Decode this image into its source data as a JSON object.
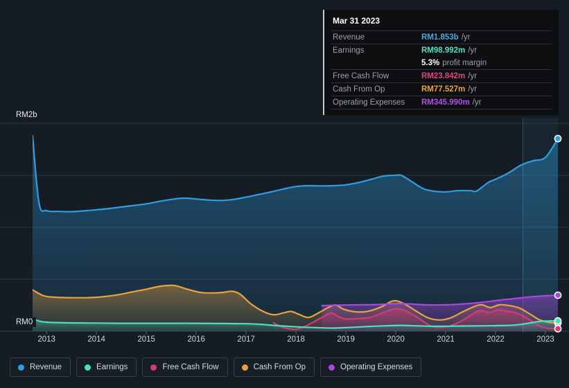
{
  "background_color": "#151c24",
  "tooltip": {
    "date": "Mar 31 2023",
    "rows": [
      {
        "label": "Revenue",
        "value": "RM1.853b",
        "unit": "/yr",
        "color": "#49a7e8"
      },
      {
        "label": "Earnings",
        "value": "RM98.992m",
        "unit": "/yr",
        "color": "#4ce0c0"
      },
      {
        "label": "",
        "value": "5.3%",
        "unit": "profit margin",
        "color": "#ffffff"
      },
      {
        "label": "Free Cash Flow",
        "value": "RM23.842m",
        "unit": "/yr",
        "color": "#e0457c"
      },
      {
        "label": "Cash From Op",
        "value": "RM77.527m",
        "unit": "/yr",
        "color": "#e8a33d"
      },
      {
        "label": "Operating Expenses",
        "value": "RM345.990m",
        "unit": "/yr",
        "color": "#b44ce8"
      }
    ]
  },
  "axes": {
    "y_top_label": "RM2b",
    "y_zero_label": "RM0",
    "x_labels": [
      "2013",
      "2014",
      "2015",
      "2016",
      "2017",
      "2018",
      "2019",
      "2020",
      "2021",
      "2022",
      "2023"
    ]
  },
  "legend": [
    {
      "label": "Revenue",
      "color": "#2f9ee0"
    },
    {
      "label": "Earnings",
      "color": "#4ce0c0"
    },
    {
      "label": "Free Cash Flow",
      "color": "#d63b6f"
    },
    {
      "label": "Cash From Op",
      "color": "#e8a33d"
    },
    {
      "label": "Operating Expenses",
      "color": "#ab47e0"
    }
  ],
  "chart_data": {
    "type": "area",
    "title": "",
    "xlabel": "",
    "ylabel": "",
    "currency": "RM",
    "ylim": [
      0,
      2000000000
    ],
    "ytick_labels": [
      "RM0",
      "RM2b"
    ],
    "grid": true,
    "legend_position": "bottom",
    "x_axis_years": [
      "2013",
      "2014",
      "2015",
      "2016",
      "2017",
      "2018",
      "2019",
      "2020",
      "2021",
      "2022",
      "2023"
    ],
    "forecast_divider_year": 2022.55,
    "series": [
      {
        "name": "Revenue",
        "color": "#2f9ee0",
        "unit": "RM",
        "latest_value": "RM1.853b",
        "points": [
          [
            2012.72,
            1880
          ],
          [
            2012.85,
            1230
          ],
          [
            2013.0,
            1160
          ],
          [
            2013.25,
            1152
          ],
          [
            2013.5,
            1150
          ],
          [
            2013.75,
            1158
          ],
          [
            2014.0,
            1168
          ],
          [
            2014.25,
            1180
          ],
          [
            2014.5,
            1195
          ],
          [
            2014.75,
            1210
          ],
          [
            2015.0,
            1225
          ],
          [
            2015.25,
            1248
          ],
          [
            2015.5,
            1268
          ],
          [
            2015.75,
            1280
          ],
          [
            2016.0,
            1272
          ],
          [
            2016.25,
            1262
          ],
          [
            2016.5,
            1258
          ],
          [
            2016.75,
            1268
          ],
          [
            2017.0,
            1290
          ],
          [
            2017.25,
            1315
          ],
          [
            2017.5,
            1340
          ],
          [
            2017.75,
            1368
          ],
          [
            2018.0,
            1392
          ],
          [
            2018.25,
            1400
          ],
          [
            2018.5,
            1398
          ],
          [
            2018.75,
            1400
          ],
          [
            2019.0,
            1408
          ],
          [
            2019.25,
            1430
          ],
          [
            2019.5,
            1460
          ],
          [
            2019.75,
            1492
          ],
          [
            2020.0,
            1500
          ],
          [
            2020.12,
            1498
          ],
          [
            2020.35,
            1430
          ],
          [
            2020.55,
            1372
          ],
          [
            2020.75,
            1348
          ],
          [
            2021.0,
            1340
          ],
          [
            2021.25,
            1352
          ],
          [
            2021.5,
            1352
          ],
          [
            2021.62,
            1348
          ],
          [
            2021.85,
            1430
          ],
          [
            2022.0,
            1462
          ],
          [
            2022.25,
            1520
          ],
          [
            2022.5,
            1595
          ],
          [
            2022.75,
            1640
          ],
          [
            2023.0,
            1672
          ],
          [
            2023.25,
            1853
          ]
        ]
      },
      {
        "name": "Earnings",
        "color": "#4ce0c0",
        "unit": "RM",
        "latest_value": "RM98.992m",
        "points": [
          [
            2012.72,
            118
          ],
          [
            2012.9,
            92
          ],
          [
            2013.1,
            84
          ],
          [
            2013.5,
            80
          ],
          [
            2014.0,
            78
          ],
          [
            2014.5,
            76
          ],
          [
            2015.0,
            76
          ],
          [
            2015.5,
            76
          ],
          [
            2016.0,
            76
          ],
          [
            2016.5,
            74
          ],
          [
            2017.0,
            72
          ],
          [
            2017.3,
            66
          ],
          [
            2017.6,
            54
          ],
          [
            2018.0,
            42
          ],
          [
            2018.4,
            34
          ],
          [
            2018.7,
            30
          ],
          [
            2019.0,
            34
          ],
          [
            2019.4,
            44
          ],
          [
            2019.8,
            52
          ],
          [
            2020.1,
            56
          ],
          [
            2020.4,
            52
          ],
          [
            2020.7,
            48
          ],
          [
            2021.0,
            48
          ],
          [
            2021.4,
            50
          ],
          [
            2021.8,
            52
          ],
          [
            2022.1,
            54
          ],
          [
            2022.35,
            58
          ],
          [
            2022.6,
            72
          ],
          [
            2022.85,
            92
          ],
          [
            2023.05,
            98
          ],
          [
            2023.25,
            99
          ]
        ]
      },
      {
        "name": "Free Cash Flow",
        "color": "#d63b6f",
        "unit": "RM",
        "latest_value": "RM23.842m",
        "starts_at_year": 2017.55,
        "points": [
          [
            2017.55,
            80
          ],
          [
            2017.75,
            36
          ],
          [
            2018.0,
            18
          ],
          [
            2018.25,
            62
          ],
          [
            2018.5,
            128
          ],
          [
            2018.7,
            176
          ],
          [
            2018.85,
            140
          ],
          [
            2019.0,
            118
          ],
          [
            2019.25,
            122
          ],
          [
            2019.5,
            134
          ],
          [
            2019.75,
            180
          ],
          [
            2020.0,
            216
          ],
          [
            2020.2,
            196
          ],
          [
            2020.45,
            128
          ],
          [
            2020.7,
            50
          ],
          [
            2020.9,
            38
          ],
          [
            2021.1,
            52
          ],
          [
            2021.35,
            108
          ],
          [
            2021.55,
            168
          ],
          [
            2021.7,
            200
          ],
          [
            2021.88,
            180
          ],
          [
            2022.05,
            206
          ],
          [
            2022.25,
            192
          ],
          [
            2022.45,
            170
          ],
          [
            2022.65,
            120
          ],
          [
            2022.85,
            58
          ],
          [
            2023.05,
            28
          ],
          [
            2023.25,
            24
          ]
        ]
      },
      {
        "name": "Cash From Op",
        "color": "#e8a33d",
        "unit": "RM",
        "latest_value": "RM77.527m",
        "points": [
          [
            2012.72,
            398
          ],
          [
            2012.95,
            340
          ],
          [
            2013.2,
            326
          ],
          [
            2013.6,
            322
          ],
          [
            2014.0,
            326
          ],
          [
            2014.4,
            348
          ],
          [
            2014.7,
            376
          ],
          [
            2015.0,
            404
          ],
          [
            2015.25,
            430
          ],
          [
            2015.45,
            440
          ],
          [
            2015.6,
            436
          ],
          [
            2015.85,
            400
          ],
          [
            2016.1,
            372
          ],
          [
            2016.35,
            368
          ],
          [
            2016.55,
            374
          ],
          [
            2016.72,
            384
          ],
          [
            2016.88,
            356
          ],
          [
            2017.1,
            262
          ],
          [
            2017.35,
            188
          ],
          [
            2017.55,
            158
          ],
          [
            2017.75,
            176
          ],
          [
            2017.9,
            190
          ],
          [
            2018.05,
            164
          ],
          [
            2018.25,
            132
          ],
          [
            2018.45,
            176
          ],
          [
            2018.65,
            228
          ],
          [
            2018.8,
            252
          ],
          [
            2018.95,
            212
          ],
          [
            2019.2,
            186
          ],
          [
            2019.45,
            192
          ],
          [
            2019.7,
            232
          ],
          [
            2019.95,
            292
          ],
          [
            2020.15,
            268
          ],
          [
            2020.4,
            196
          ],
          [
            2020.65,
            128
          ],
          [
            2020.88,
            108
          ],
          [
            2021.1,
            128
          ],
          [
            2021.35,
            188
          ],
          [
            2021.58,
            238
          ],
          [
            2021.72,
            254
          ],
          [
            2021.9,
            228
          ],
          [
            2022.08,
            254
          ],
          [
            2022.28,
            246
          ],
          [
            2022.48,
            222
          ],
          [
            2022.68,
            168
          ],
          [
            2022.88,
            110
          ],
          [
            2023.08,
            84
          ],
          [
            2023.25,
            78
          ]
        ]
      },
      {
        "name": "Operating Expenses",
        "color": "#ab47e0",
        "unit": "RM",
        "latest_value": "RM345.990m",
        "starts_at_year": 2018.52,
        "points": [
          [
            2018.52,
            246
          ],
          [
            2018.8,
            250
          ],
          [
            2019.05,
            252
          ],
          [
            2019.35,
            254
          ],
          [
            2019.6,
            256
          ],
          [
            2019.85,
            262
          ],
          [
            2020.05,
            266
          ],
          [
            2020.3,
            262
          ],
          [
            2020.55,
            254
          ],
          [
            2020.8,
            252
          ],
          [
            2021.05,
            254
          ],
          [
            2021.35,
            262
          ],
          [
            2021.65,
            274
          ],
          [
            2021.9,
            288
          ],
          [
            2022.1,
            300
          ],
          [
            2022.35,
            312
          ],
          [
            2022.6,
            326
          ],
          [
            2022.85,
            336
          ],
          [
            2023.05,
            342
          ],
          [
            2023.25,
            346
          ]
        ]
      }
    ]
  }
}
